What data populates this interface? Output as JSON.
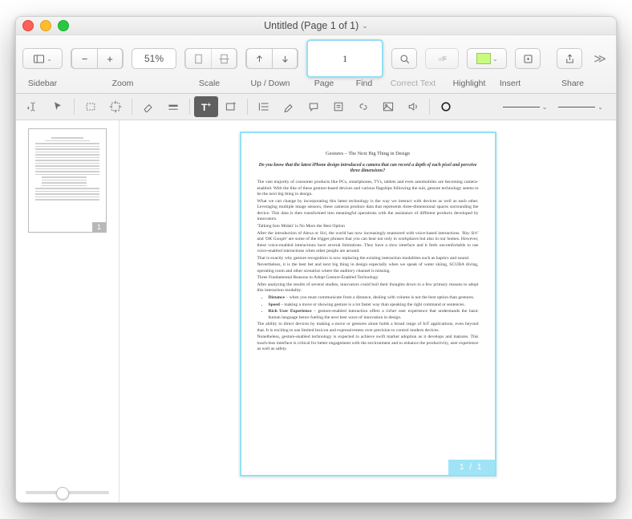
{
  "window": {
    "title": "Untitled (Page 1 of 1)"
  },
  "toolbar": {
    "sidebar_label": "Sidebar",
    "zoom_label": "Zoom",
    "zoom_value": "51%",
    "scale_label": "Scale",
    "updown_label": "Up / Down",
    "page_label": "Page",
    "page_value": "1",
    "find_label": "Find",
    "correct_label": "Correct Text",
    "highlight_label": "Highlight",
    "highlight_color": "#c8fc7f",
    "insert_label": "Insert",
    "share_label": "Share"
  },
  "thumbnail": {
    "page_label": "1"
  },
  "slider": {
    "value": 38
  },
  "page_badge": "1 / 1",
  "doc": {
    "title": "Gestures – The Next Big Thing in Design",
    "lead": "Do you know that the latest iPhone design introduced a camera that can record a depth of each pixel and perceive three dimensions?",
    "p1": "The vast majority of consumer products like PCs, smartphones, TVs, tablets and even automobiles are becoming camera-enabled. With the like of these gesture-based devices and various flagships following the suit, gesture technology seems to be the next big thing in design.",
    "p2": "What we can change by incorporating this latest technology is the way we interact with devices as well as each other. Leveraging multiple image sensors, these cameras produce data that represents three-dimensional spaces surrounding the device. This data is then transformed into meaningful operations with the assistance of different products developed by innovators.",
    "h2a": "'Talking Into Midair' is No More the Best Option",
    "p3a": "After the introduction of Alexa or Siri, the world has now increasingly enamored with voice-based interactions. ",
    "p3b": "'Hey Siri'",
    "p3c": " and ",
    "p3d": "'OK Google'",
    "p3e": " are some of the trigger phrases that you can hear not only in workplaces but also in our homes. However, these voice-enabled interactions have several limitations. They have a slow interface and it feels uncomfortable to use voice-enabled interactions when other people are around.",
    "p4": "That is exactly why gesture recognition is now replacing the existing interaction modalities such as haptics and sound.",
    "p5": "Nevertheless, it is the best bet and next big thing in design especially when we speak of water skiing, SCUBA diving, operating room and other scenarios where the auditory channel is missing.",
    "h2b": "Three Fundamental Reasons to Adopt Gesture-Enabled Technology",
    "p6": "After analyzing the results of several studies, innovators could boil their thoughts down to a few primary reasons to adopt this interaction modality.",
    "li1_b": "Distance",
    "li1": " – when you must communicate from a distance, dealing with volume is not the best option than gestures.",
    "li2_b": "Speed",
    "li2": " – making a move or showing gesture is a lot faster way than speaking the right command or sentences.",
    "li3_b": "Rich User Experience",
    "li3": " – gesture-enabled interaction offers a richer user experience that understands the basic human language hence fueling the next best wave of innovation in design.",
    "p7": "The ability to direct devices by making a move or gestures alone holds a broad range of IoT applications, even beyond that. It is exciting to use limited lexicon and expressiveness over precision to control modern devices.",
    "p8": "Nonetheless, gesture-enabled technology is expected to achieve swift market adoption as it develops and matures. This touch-less interface is critical for better engagement with the environment and to enhance the productivity, user experience as well as safety."
  }
}
